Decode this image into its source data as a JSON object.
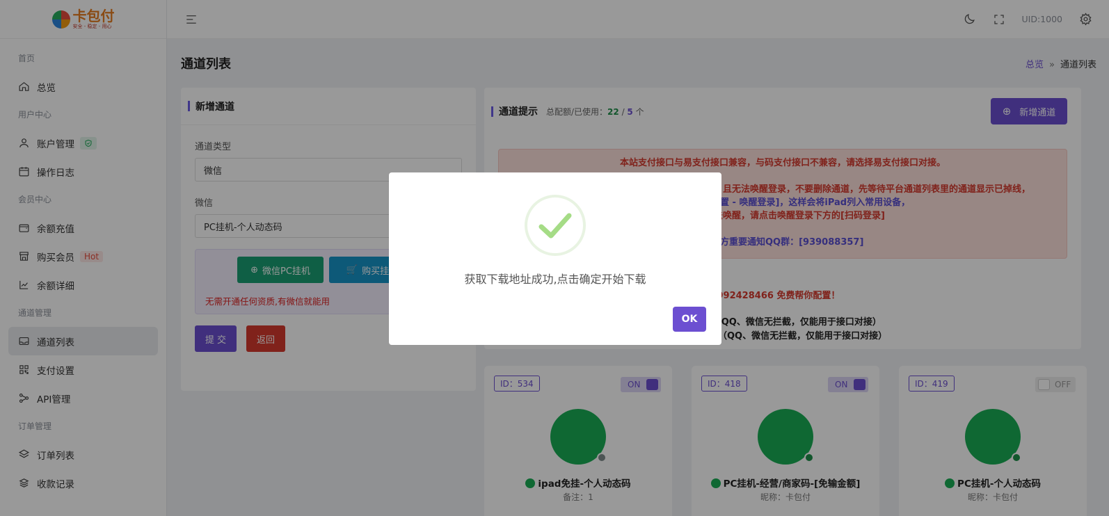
{
  "logo": {
    "name": "卡包付",
    "slogan": "安全 - 稳定 - 用心"
  },
  "sidebar": {
    "groups": [
      "首页",
      "用户中心",
      "会员中心",
      "通道管理",
      "订单管理"
    ],
    "items": [
      {
        "label": "总览",
        "icon": "home-icon"
      },
      {
        "label": "账户管理",
        "icon": "user-icon"
      },
      {
        "label": "操作日志",
        "icon": "calendar-icon"
      },
      {
        "label": "余额充值",
        "icon": "wallet-icon"
      },
      {
        "label": "购买会员",
        "icon": "store-icon",
        "badge": "Hot"
      },
      {
        "label": "余额详细",
        "icon": "chart-icon"
      },
      {
        "label": "通道列表",
        "icon": "inbox-icon"
      },
      {
        "label": "支付设置",
        "icon": "grid-icon"
      },
      {
        "label": "API管理",
        "icon": "share-icon"
      },
      {
        "label": "订单列表",
        "icon": "layers-icon"
      },
      {
        "label": "收款记录",
        "icon": "stack-icon"
      }
    ]
  },
  "topbar": {
    "uid": "UID:1000"
  },
  "page": {
    "title": "通道列表",
    "crumb_home": "总览",
    "crumb_sep": "»",
    "crumb_current": "通道列表"
  },
  "form": {
    "title": "新增通道",
    "type_label": "通道类型",
    "type_value": "微信",
    "wx_label": "微信",
    "wx_value": "PC挂机-个人动态码",
    "btn_pc": "微信PC挂机",
    "btn_buy": "购买挂机",
    "note": "无需开通任何资质,有微信就能用",
    "submit": "提 交",
    "back": "返回"
  },
  "channels": {
    "title": "通道提示",
    "quota_label": "总配额/已使用：",
    "quota_total": "22",
    "quota_slash": " / ",
    "quota_used": "5",
    "quota_unit": " 个",
    "add_btn": "新增通道"
  },
  "alert": {
    "line1": "本站支付接口与易支付接口兼容，与码支付接口不兼容，请选择易支付接口对接。",
    "line2": "了，且无法唤醒登录，不要删除通道，先等待平台通道列表里的通道显示已掉线，",
    "line3": "配置 - 唤醒登录]，这样会将iPad列入常用设备，",
    "line4": "无法唤醒，请点击唤醒登录下方的[扫码登录]",
    "line5": "官方重要通知QQ群：[939088357]"
  },
  "info": {
    "line1": "（微信同号）：992428466 免费帮你配置！",
    "line2": "/（QQ、微信无拦截，仅能用于接口对接）",
    "line3": "op/（QQ、微信无拦截，仅能用于接口对接）"
  },
  "cards": [
    {
      "id": "ID：534",
      "toggle": "ON",
      "name": "ipad免挂-个人动态码",
      "sub": "备注：1",
      "dot": "#7f8c8d"
    },
    {
      "id": "ID：418",
      "toggle": "ON",
      "name": "PC挂机-经营/商家码-[免输金额]",
      "sub": "昵称：卡包付",
      "dot": "#1e8f4a"
    },
    {
      "id": "ID：419",
      "toggle": "OFF",
      "name": "PC挂机-个人动态码",
      "sub": "昵称：卡包付",
      "dot": "#1e8f4a"
    }
  ],
  "modal": {
    "message": "获取下载地址成功,点击确定开始下载",
    "ok": "OK"
  },
  "colors": {
    "accent": "#6c4fd1",
    "success": "#a5dc86",
    "wechat": "#1aad55"
  }
}
